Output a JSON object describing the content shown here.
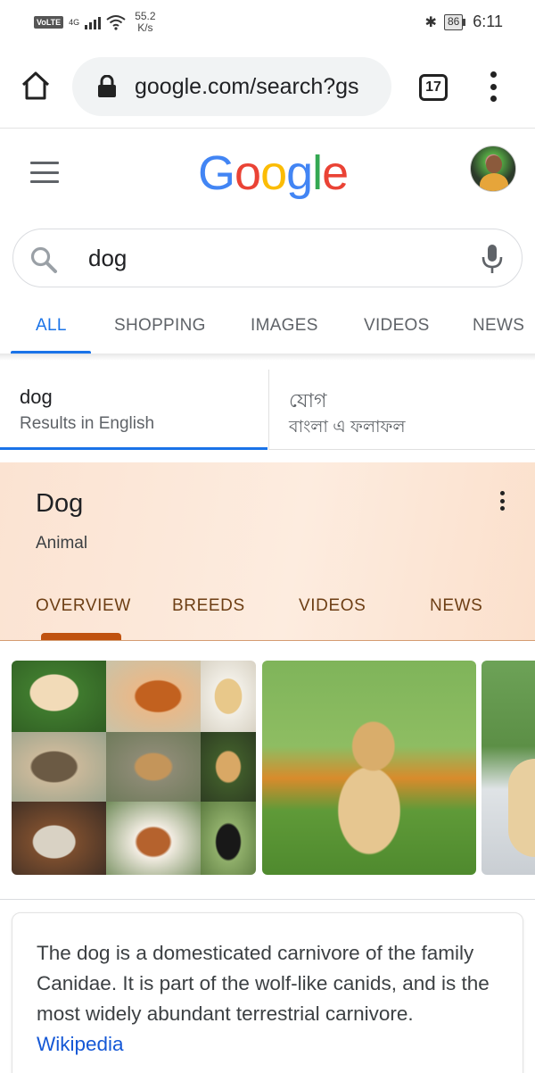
{
  "status_bar": {
    "volte": "VoLTE",
    "network": "4G",
    "speed_value": "55.2",
    "speed_unit": "K/s",
    "battery": "86",
    "time": "6:11"
  },
  "browser": {
    "url": "google.com/search?gs",
    "tab_count": "17"
  },
  "header": {
    "logo_letters": [
      {
        "ch": "G",
        "color": "#4285F4"
      },
      {
        "ch": "o",
        "color": "#EA4335"
      },
      {
        "ch": "o",
        "color": "#FBBC05"
      },
      {
        "ch": "g",
        "color": "#4285F4"
      },
      {
        "ch": "l",
        "color": "#34A853"
      },
      {
        "ch": "e",
        "color": "#EA4335"
      }
    ]
  },
  "search": {
    "query": "dog"
  },
  "tabs": [
    "ALL",
    "SHOPPING",
    "IMAGES",
    "VIDEOS",
    "NEWS"
  ],
  "language": {
    "english": {
      "term": "dog",
      "label": "Results in English"
    },
    "bengali": {
      "term": "যোগ",
      "label": "বাংলা এ ফলাফল"
    }
  },
  "knowledge_panel": {
    "title": "Dog",
    "subtitle": "Animal",
    "tabs": [
      "OVERVIEW",
      "BREEDS",
      "VIDEOS",
      "NEWS"
    ]
  },
  "description": {
    "text": "The dog is a domesticated carnivore of the family Canidae. It is part of the wolf-like canids, and is the most widely abundant terrestrial carnivore.",
    "source": "Wikipedia"
  },
  "colors": {
    "accent": "#1a73e8",
    "kp_tab_text": "#6d3e14",
    "kp_underline": "#c0520f"
  }
}
